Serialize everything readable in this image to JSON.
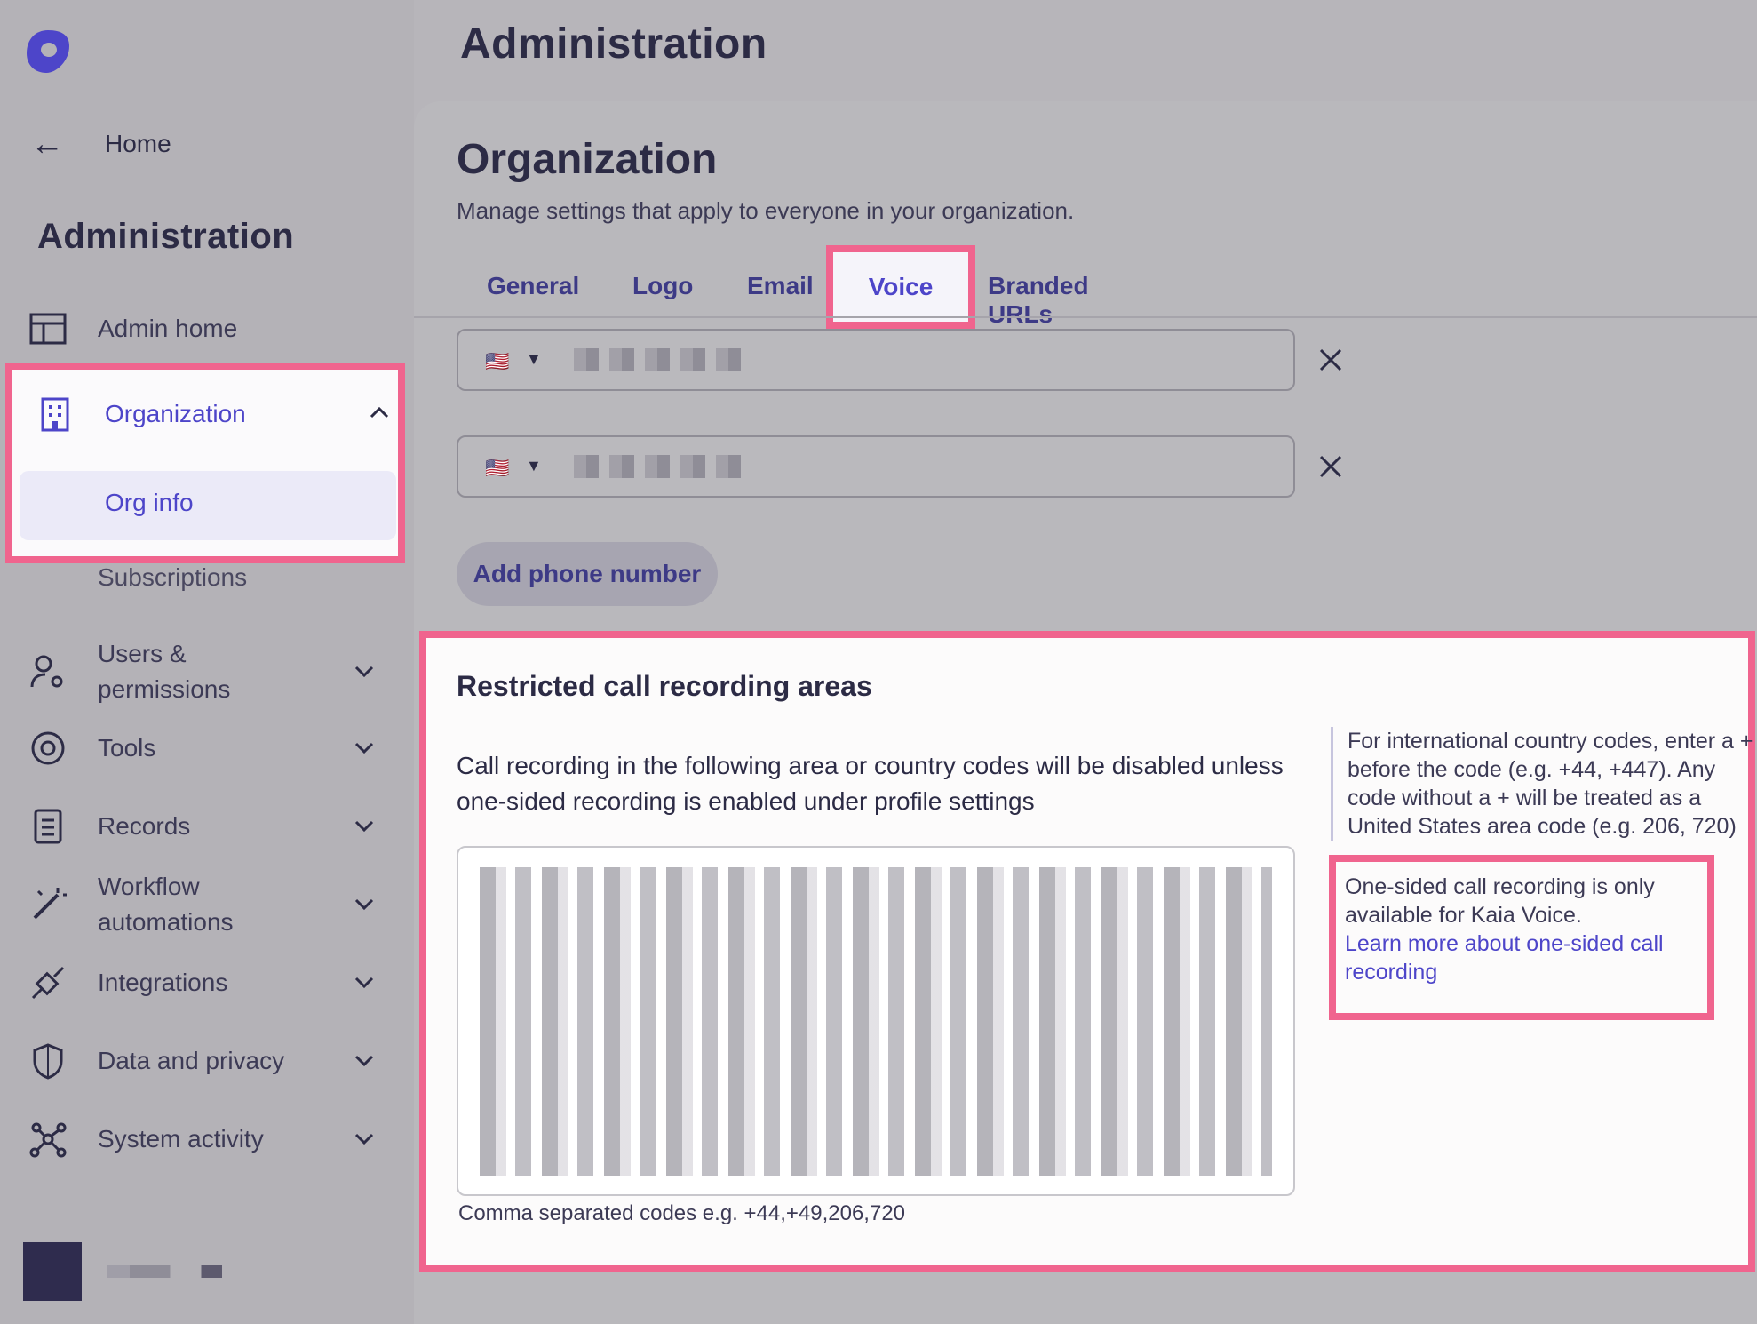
{
  "sidebar": {
    "home_label": "Home",
    "title": "Administration",
    "admin_home": "Admin home",
    "organization": "Organization",
    "org_info": "Org info",
    "subscriptions": "Subscriptions",
    "users_permissions_1": "Users &",
    "users_permissions_2": "permissions",
    "tools": "Tools",
    "records": "Records",
    "workflow_1": "Workflow",
    "workflow_2": "automations",
    "integrations": "Integrations",
    "data_privacy": "Data and privacy",
    "system_activity": "System activity"
  },
  "header": {
    "title": "Administration"
  },
  "main": {
    "title": "Organization",
    "description": "Manage settings that apply to everyone in your organization.",
    "tabs": [
      "General",
      "Logo",
      "Email",
      "Voice",
      "Branded URLs"
    ],
    "active_tab": "Voice",
    "phone_flag": "🇺🇸",
    "add_phone": "Add phone number"
  },
  "recording": {
    "title": "Restricted call recording areas",
    "description": "Call recording in the following area or country codes will be disabled unless one-sided recording is enabled under profile settings",
    "hint": "Comma separated codes e.g. +44,+49,206,720",
    "side_note": "For international country codes, enter a + before the code (e.g. +44, +447). Any code without a + will be treated as a United States area code (e.g. 206, 720)",
    "kaia_note": "One-sided call recording is only available for Kaia Voice.",
    "learn_more": "Learn more about one-sided call recording"
  },
  "colors": {
    "accent": "#4d45c9",
    "highlight": "#f0648e",
    "text": "#2c2b45"
  }
}
